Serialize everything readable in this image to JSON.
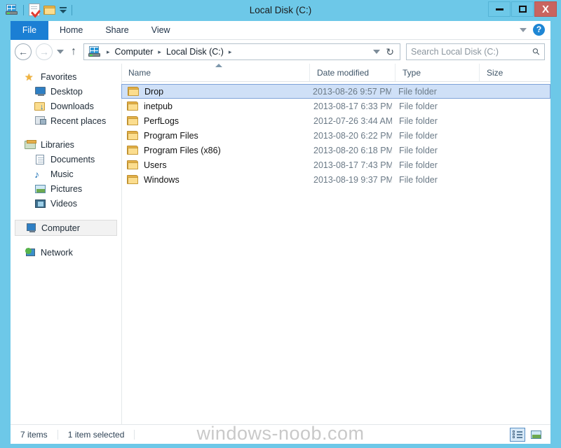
{
  "window": {
    "title": "Local Disk (C:)",
    "minimize_label": "Minimize",
    "maximize_label": "Maximize",
    "close_label": "X",
    "accent_color": "#6dc8e8",
    "close_color": "#c9645f"
  },
  "quick_access": {
    "items": [
      {
        "name": "computer-icon",
        "label": "Computer"
      },
      {
        "name": "properties-icon",
        "label": "Properties"
      },
      {
        "name": "new-folder-icon",
        "label": "New folder"
      },
      {
        "name": "customize-icon",
        "label": "Customize Quick Access Toolbar"
      }
    ]
  },
  "ribbon": {
    "tabs": [
      {
        "label": "File",
        "active": true
      },
      {
        "label": "Home",
        "active": false
      },
      {
        "label": "Share",
        "active": false
      },
      {
        "label": "View",
        "active": false
      }
    ],
    "collapse_label": "Minimize the Ribbon",
    "help_label": "?",
    "file_tab_color": "#1b7fd4"
  },
  "address": {
    "back_label": "←",
    "forward_label": "→",
    "history_label": "Recent locations",
    "up_label": "↑",
    "crumbs": [
      {
        "label": "Computer"
      },
      {
        "label": "Local Disk (C:)"
      }
    ],
    "crumb_separator": "▸",
    "refresh_label": "↻"
  },
  "search": {
    "placeholder": "Search Local Disk (C:)",
    "icon": "search-icon"
  },
  "sidebar": {
    "groups": [
      {
        "header": {
          "label": "Favorites",
          "icon": "star-icon"
        },
        "items": [
          {
            "label": "Desktop",
            "icon": "desktop-icon"
          },
          {
            "label": "Downloads",
            "icon": "downloads-icon"
          },
          {
            "label": "Recent places",
            "icon": "recent-places-icon"
          }
        ]
      },
      {
        "header": {
          "label": "Libraries",
          "icon": "libraries-icon"
        },
        "items": [
          {
            "label": "Documents",
            "icon": "documents-icon"
          },
          {
            "label": "Music",
            "icon": "music-icon"
          },
          {
            "label": "Pictures",
            "icon": "pictures-icon"
          },
          {
            "label": "Videos",
            "icon": "videos-icon"
          }
        ]
      },
      {
        "header": {
          "label": "Computer",
          "icon": "computer-icon",
          "selected": true
        },
        "items": []
      },
      {
        "header": {
          "label": "Network",
          "icon": "network-icon"
        },
        "items": []
      }
    ]
  },
  "filelist": {
    "columns": [
      {
        "label": "Name",
        "sorted": "asc"
      },
      {
        "label": "Date modified"
      },
      {
        "label": "Type"
      },
      {
        "label": "Size"
      }
    ],
    "rows": [
      {
        "name": "Drop",
        "date": "2013-08-26 9:57 PM",
        "type": "File folder",
        "size": "",
        "selected": true
      },
      {
        "name": "inetpub",
        "date": "2013-08-17 6:33 PM",
        "type": "File folder",
        "size": "",
        "selected": false
      },
      {
        "name": "PerfLogs",
        "date": "2012-07-26 3:44 AM",
        "type": "File folder",
        "size": "",
        "selected": false
      },
      {
        "name": "Program Files",
        "date": "2013-08-20 6:22 PM",
        "type": "File folder",
        "size": "",
        "selected": false
      },
      {
        "name": "Program Files (x86)",
        "date": "2013-08-20 6:18 PM",
        "type": "File folder",
        "size": "",
        "selected": false
      },
      {
        "name": "Users",
        "date": "2013-08-17 7:43 PM",
        "type": "File folder",
        "size": "",
        "selected": false
      },
      {
        "name": "Windows",
        "date": "2013-08-19 9:37 PM",
        "type": "File folder",
        "size": "",
        "selected": false
      }
    ],
    "selection_color": "#cfe0f7"
  },
  "statusbar": {
    "item_count": "7 items",
    "selection_count": "1 item selected",
    "views": [
      {
        "name": "details-view-button",
        "active": true
      },
      {
        "name": "large-icons-view-button",
        "active": false
      }
    ]
  },
  "watermark": {
    "text": "windows-noob.com"
  }
}
